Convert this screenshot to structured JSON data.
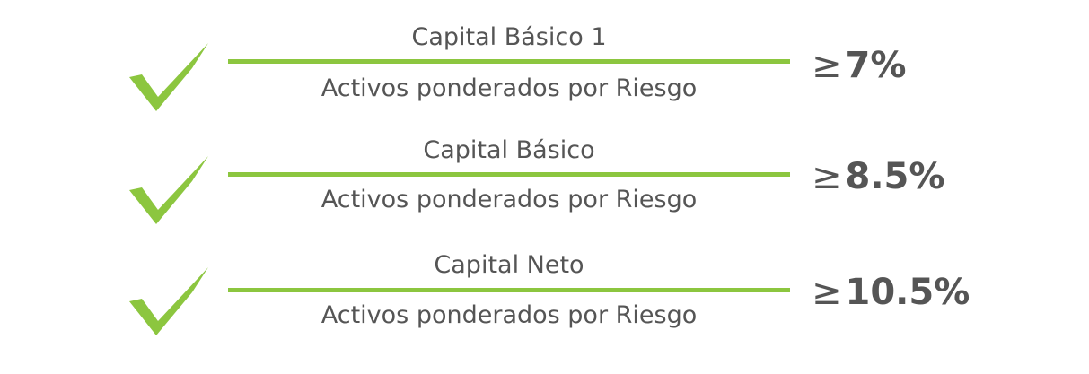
{
  "colors": {
    "accent_green": "#8cc63f",
    "text_gray": "#555555"
  },
  "icons": {
    "row_marker": "checkmark-icon"
  },
  "rows": [
    {
      "numerator": "Capital Básico 1",
      "denominator": "Activos ponderados por Riesgo",
      "operator": "≥",
      "threshold": "7%"
    },
    {
      "numerator": "Capital Básico",
      "denominator": "Activos ponderados por Riesgo",
      "operator": "≥",
      "threshold": "8.5%"
    },
    {
      "numerator": "Capital Neto",
      "denominator": "Activos ponderados por Riesgo",
      "operator": "≥",
      "threshold": "10.5%"
    }
  ]
}
